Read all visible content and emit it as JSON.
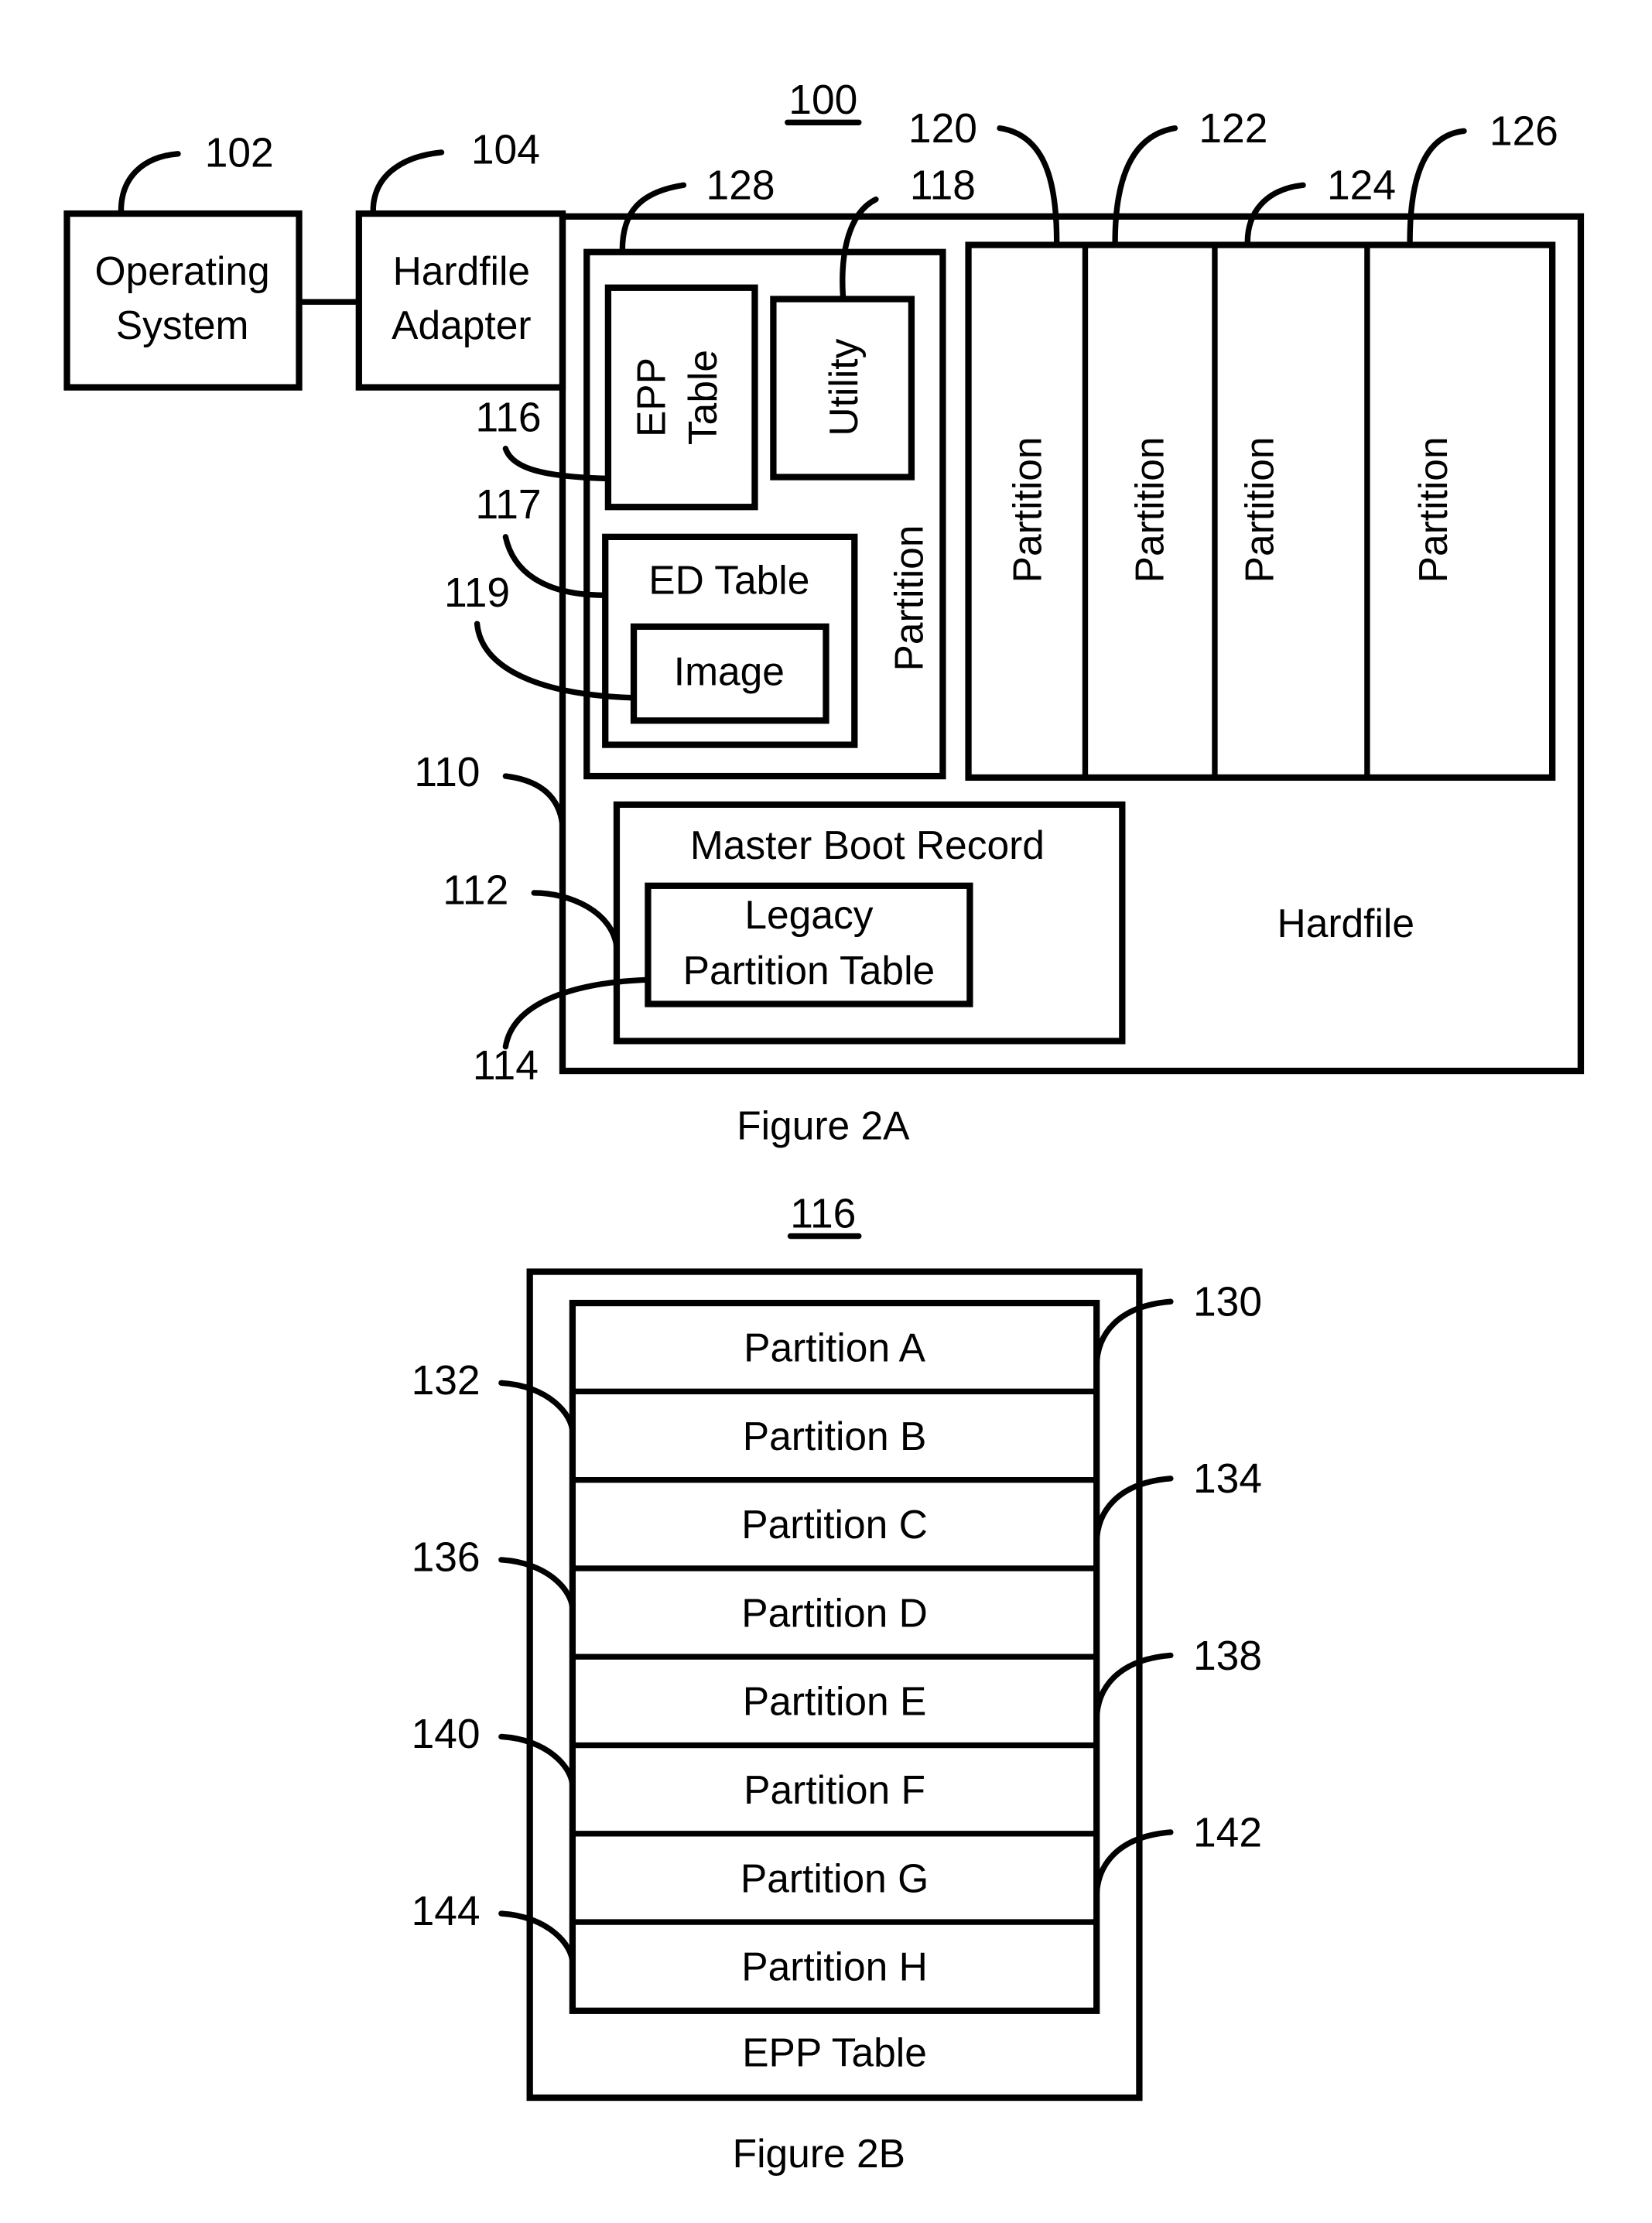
{
  "figure_2a": {
    "ref_label": "100",
    "caption": "Figure 2A",
    "os_box": {
      "label_line1": "Operating",
      "label_line2": "System",
      "ref": "102"
    },
    "adapter_box": {
      "label_line1": "Hardfile",
      "label_line2": "Adapter",
      "ref": "104"
    },
    "hardfile": {
      "label": "Hardfile",
      "ref": "110"
    },
    "utility_partition": {
      "label": "Partition",
      "ref": "128"
    },
    "epp_table": {
      "label_line1": "EPP",
      "label_line2": "Table",
      "ref": "116"
    },
    "utility": {
      "label": "Utility",
      "ref": "118"
    },
    "ed_table": {
      "label": "ED Table",
      "ref": "117"
    },
    "image": {
      "label": "Image",
      "ref": "119"
    },
    "partitions": [
      {
        "label": "Partition",
        "ref": "120"
      },
      {
        "label": "Partition",
        "ref": "122"
      },
      {
        "label": "Partition",
        "ref": "124"
      },
      {
        "label": "Partition",
        "ref": "126"
      }
    ],
    "mbr": {
      "label": "Master Boot Record",
      "ref": "112"
    },
    "legacy_table": {
      "label_line1": "Legacy",
      "label_line2": "Partition Table",
      "ref": "114"
    }
  },
  "figure_2b": {
    "ref_label": "116",
    "caption": "Figure 2B",
    "table_label": "EPP Table",
    "rows": [
      {
        "label": "Partition A",
        "ref": "130"
      },
      {
        "label": "Partition B",
        "ref": "132"
      },
      {
        "label": "Partition C",
        "ref": "134"
      },
      {
        "label": "Partition D",
        "ref": "136"
      },
      {
        "label": "Partition E",
        "ref": "138"
      },
      {
        "label": "Partition F",
        "ref": "140"
      },
      {
        "label": "Partition G",
        "ref": "142"
      },
      {
        "label": "Partition H",
        "ref": "144"
      }
    ]
  }
}
